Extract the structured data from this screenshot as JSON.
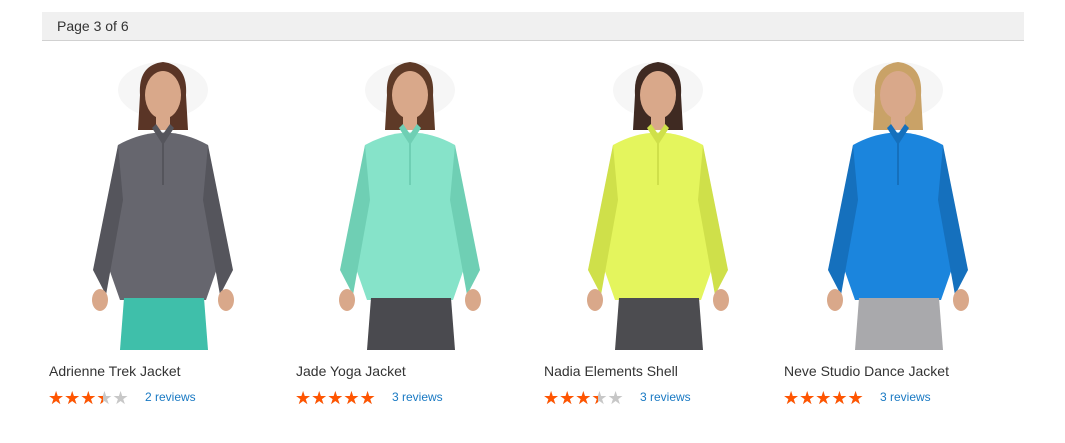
{
  "pager": {
    "label": "Page 3 of 6"
  },
  "products": [
    {
      "name": "Adrienne Trek Jacket",
      "rating_fraction": 0.6,
      "reviews": "2 reviews",
      "colors": {
        "shirt": "#66666e",
        "shirtDark": "#55555c",
        "pants": "#3fbfaa",
        "hair": "#5a3526"
      }
    },
    {
      "name": "Jade Yoga Jacket",
      "rating_fraction": 0.9,
      "reviews": "3 reviews",
      "colors": {
        "shirt": "#86e3c9",
        "shirtDark": "#6fcfb4",
        "pants": "#4a4a4f",
        "hair": "#5e3a27"
      }
    },
    {
      "name": "Nadia Elements Shell",
      "rating_fraction": 0.6,
      "reviews": "3 reviews",
      "colors": {
        "shirt": "#e4f55d",
        "shirtDark": "#cfe04a",
        "pants": "#4c4c50",
        "hair": "#3f2a22"
      }
    },
    {
      "name": "Neve Studio Dance Jacket",
      "rating_fraction": 0.9,
      "reviews": "3 reviews",
      "colors": {
        "shirt": "#1b85dd",
        "shirtDark": "#1570bd",
        "pants": "#a9a9ac",
        "hair": "#c9a267"
      }
    }
  ],
  "colors": {
    "star_on": "#ff5501",
    "star_off": "#c7c7c7",
    "link": "#1979c3",
    "skin": "#d9a88a"
  }
}
